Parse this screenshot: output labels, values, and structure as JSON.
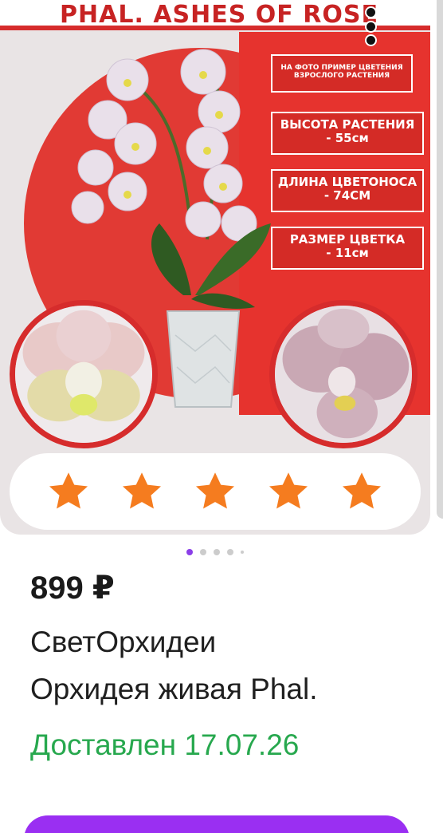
{
  "product": {
    "banner_title": "PHAL. ASHES OF ROSE",
    "tags": {
      "photo_note_line1": "НА ФОТО ПРИМЕР ЦВЕТЕНИЯ",
      "photo_note_line2": "ВЗРОСЛОГО РАСТЕНИЯ",
      "height_line1": "ВЫСОТА РАСТЕНИЯ",
      "height_line2": "- 55см",
      "stem_line1": "ДЛИНА ЦВЕТОНОСА",
      "stem_line2": "- 74СМ",
      "bloom_line1": "РАЗМЕР ЦВЕТКА",
      "bloom_line2": "- 11см"
    },
    "rating": {
      "stars": 5,
      "max": 5
    },
    "gallery": {
      "current_index": 1,
      "total_dots": 5
    },
    "price": "899 ₽",
    "seller": "СветОрхидеи",
    "name": "Орхидея живая Phal.",
    "delivery": "Доставлен 17.07.26"
  },
  "colors": {
    "accent": "#9a2ff2",
    "brand_red": "#d62c2c",
    "star": "#f57c1f",
    "delivery_green": "#27a84e"
  },
  "icons": {
    "menu": "more-vertical-icon",
    "star": "star-icon"
  }
}
